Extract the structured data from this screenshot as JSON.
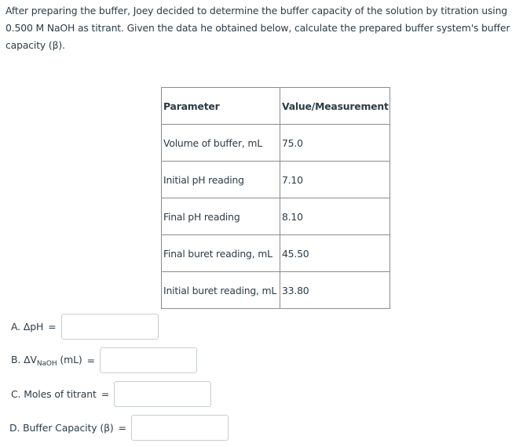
{
  "question": {
    "text": "After preparing the buffer, Joey decided to determine the buffer capacity of the solution by titration using 0.500 M NaOH as titrant. Given the data he obtained below, calculate the prepared buffer system's buffer capacity (β)."
  },
  "table": {
    "headers": [
      "Parameter",
      "Value/Measurement"
    ],
    "rows": [
      [
        "Volume of buffer, mL",
        "75.0"
      ],
      [
        "Initial pH reading",
        "7.10"
      ],
      [
        "Final pH reading",
        "8.10"
      ],
      [
        "Final buret reading, mL",
        "45.50"
      ],
      [
        "Initial buret reading, mL",
        "33.80"
      ]
    ]
  },
  "answers": [
    {
      "label": "A. ΔpH",
      "eq": "=",
      "value": ""
    },
    {
      "label_prefix": "B. ΔV",
      "label_sub": "NaOH",
      "label_suffix": " (mL)",
      "eq": "=",
      "value": ""
    },
    {
      "label": "C. Moles of titrant",
      "eq": "=",
      "value": ""
    },
    {
      "label": "D. Buffer Capacity (β)",
      "eq": "=",
      "value": ""
    }
  ]
}
